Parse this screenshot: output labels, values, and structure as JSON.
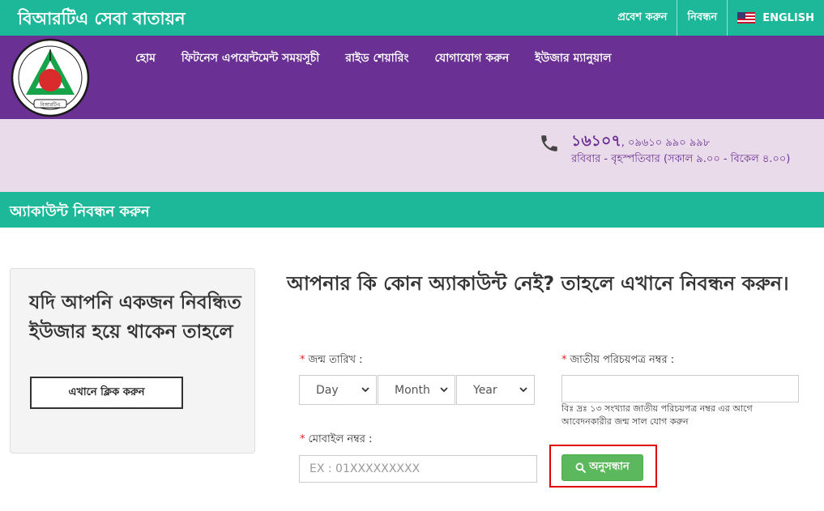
{
  "header": {
    "site_title": "বিআরটিএ সেবা বাতায়ন",
    "login_label": "প্রবেশ করুন",
    "register_label": "নিবন্ধন",
    "language_label": "ENGLISH",
    "language_icon": "us-flag-icon"
  },
  "nav": {
    "logo_text": "বিআরটিএ",
    "items": [
      {
        "label": "হোম"
      },
      {
        "label": "ফিটনেস এপয়েন্টমেন্ট সময়সূচী"
      },
      {
        "label": "রাইড শেয়ারিং"
      },
      {
        "label": "যোগাযোগ করুন"
      },
      {
        "label": "ইউজার ম্যানুয়াল"
      }
    ]
  },
  "contact": {
    "icon": "phone-icon",
    "hotline": "১৬১০৭",
    "other_numbers": ", ০৯৬১০ ৯৯০ ৯৯৮",
    "hours": "রবিবার - বৃহস্পতিবার (সকাল ৯.০০ - বিকেল ৪.০০)"
  },
  "page": {
    "section_title": "অ্যাকাউন্ট নিবন্ধন করুন"
  },
  "left_card": {
    "text": "যদি আপনি একজন নিবন্ধিত ইউজার হয়ে থাকেন তাহলে",
    "button_label": "এখানে ক্লিক করুন"
  },
  "form": {
    "heading": "আপনার কি কোন অ্যাকাউন্ট নেই? তাহলে এখানে নিবন্ধন করুন।",
    "required_mark": "*",
    "dob_label": "জন্ম তারিখ :",
    "day_selected": "Day",
    "month_selected": "Month",
    "year_selected": "Year",
    "nid_label": "জাতীয় পরিচয়পত্র নম্বর :",
    "nid_value": "",
    "nid_help": "বিঃ দ্রঃ ১৩ সংখ্যার জাতীয় পরিচয়পত্র নম্বর এর আগে আবেদনকারীর জন্ম সাল যোগ করুন",
    "mobile_label": "মোবাইল নম্বর :",
    "mobile_placeholder": "EX : 01XXXXXXXXX",
    "search_label": "অনুসন্ধান",
    "search_icon": "search-icon"
  },
  "colors": {
    "teal": "#1cb899",
    "purple": "#6a3093",
    "light_purple": "#eadbeb",
    "green_button": "#5cb85c",
    "highlight_red": "#e00000"
  }
}
